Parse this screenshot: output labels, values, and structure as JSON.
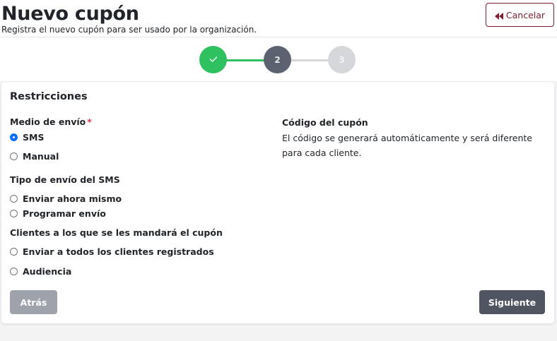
{
  "header": {
    "title": "Nuevo cupón",
    "subtitle": "Registra el nuevo cupón para ser usado por la organización.",
    "cancel_label": "Cancelar",
    "cancel_icon": "double-chevron-left-icon",
    "cancel_color": "#7a1f2f"
  },
  "stepper": {
    "steps": [
      {
        "label": "",
        "state": "completed",
        "color": "#2fc160",
        "icon": "check-icon"
      },
      {
        "label": "2",
        "state": "active",
        "color": "#5d6270"
      },
      {
        "label": "3",
        "state": "pending",
        "color": "#d6d7db"
      }
    ]
  },
  "form": {
    "section_title": "Restricciones",
    "shipping_method": {
      "label": "Medio de envío",
      "required_mark": "*",
      "options": [
        {
          "label": "SMS",
          "checked": true
        },
        {
          "label": "Manual",
          "checked": false
        }
      ]
    },
    "sms_send_type": {
      "label": "Tipo de envío del SMS",
      "options": [
        {
          "label": "Enviar ahora mismo",
          "checked": false
        },
        {
          "label": "Programar envío",
          "checked": false
        }
      ]
    },
    "recipients": {
      "label": "Clientes a los que se les mandará el cupón",
      "options": [
        {
          "label": "Enviar a todos los clientes registrados",
          "checked": false
        },
        {
          "label": "Audiencia",
          "checked": false
        }
      ]
    },
    "coupon_code": {
      "title": "Código del cupón",
      "description": "El código se generará automáticamente y será diferente para cada cliente."
    },
    "back_label": "Atrás",
    "next_label": "Siguiente"
  }
}
